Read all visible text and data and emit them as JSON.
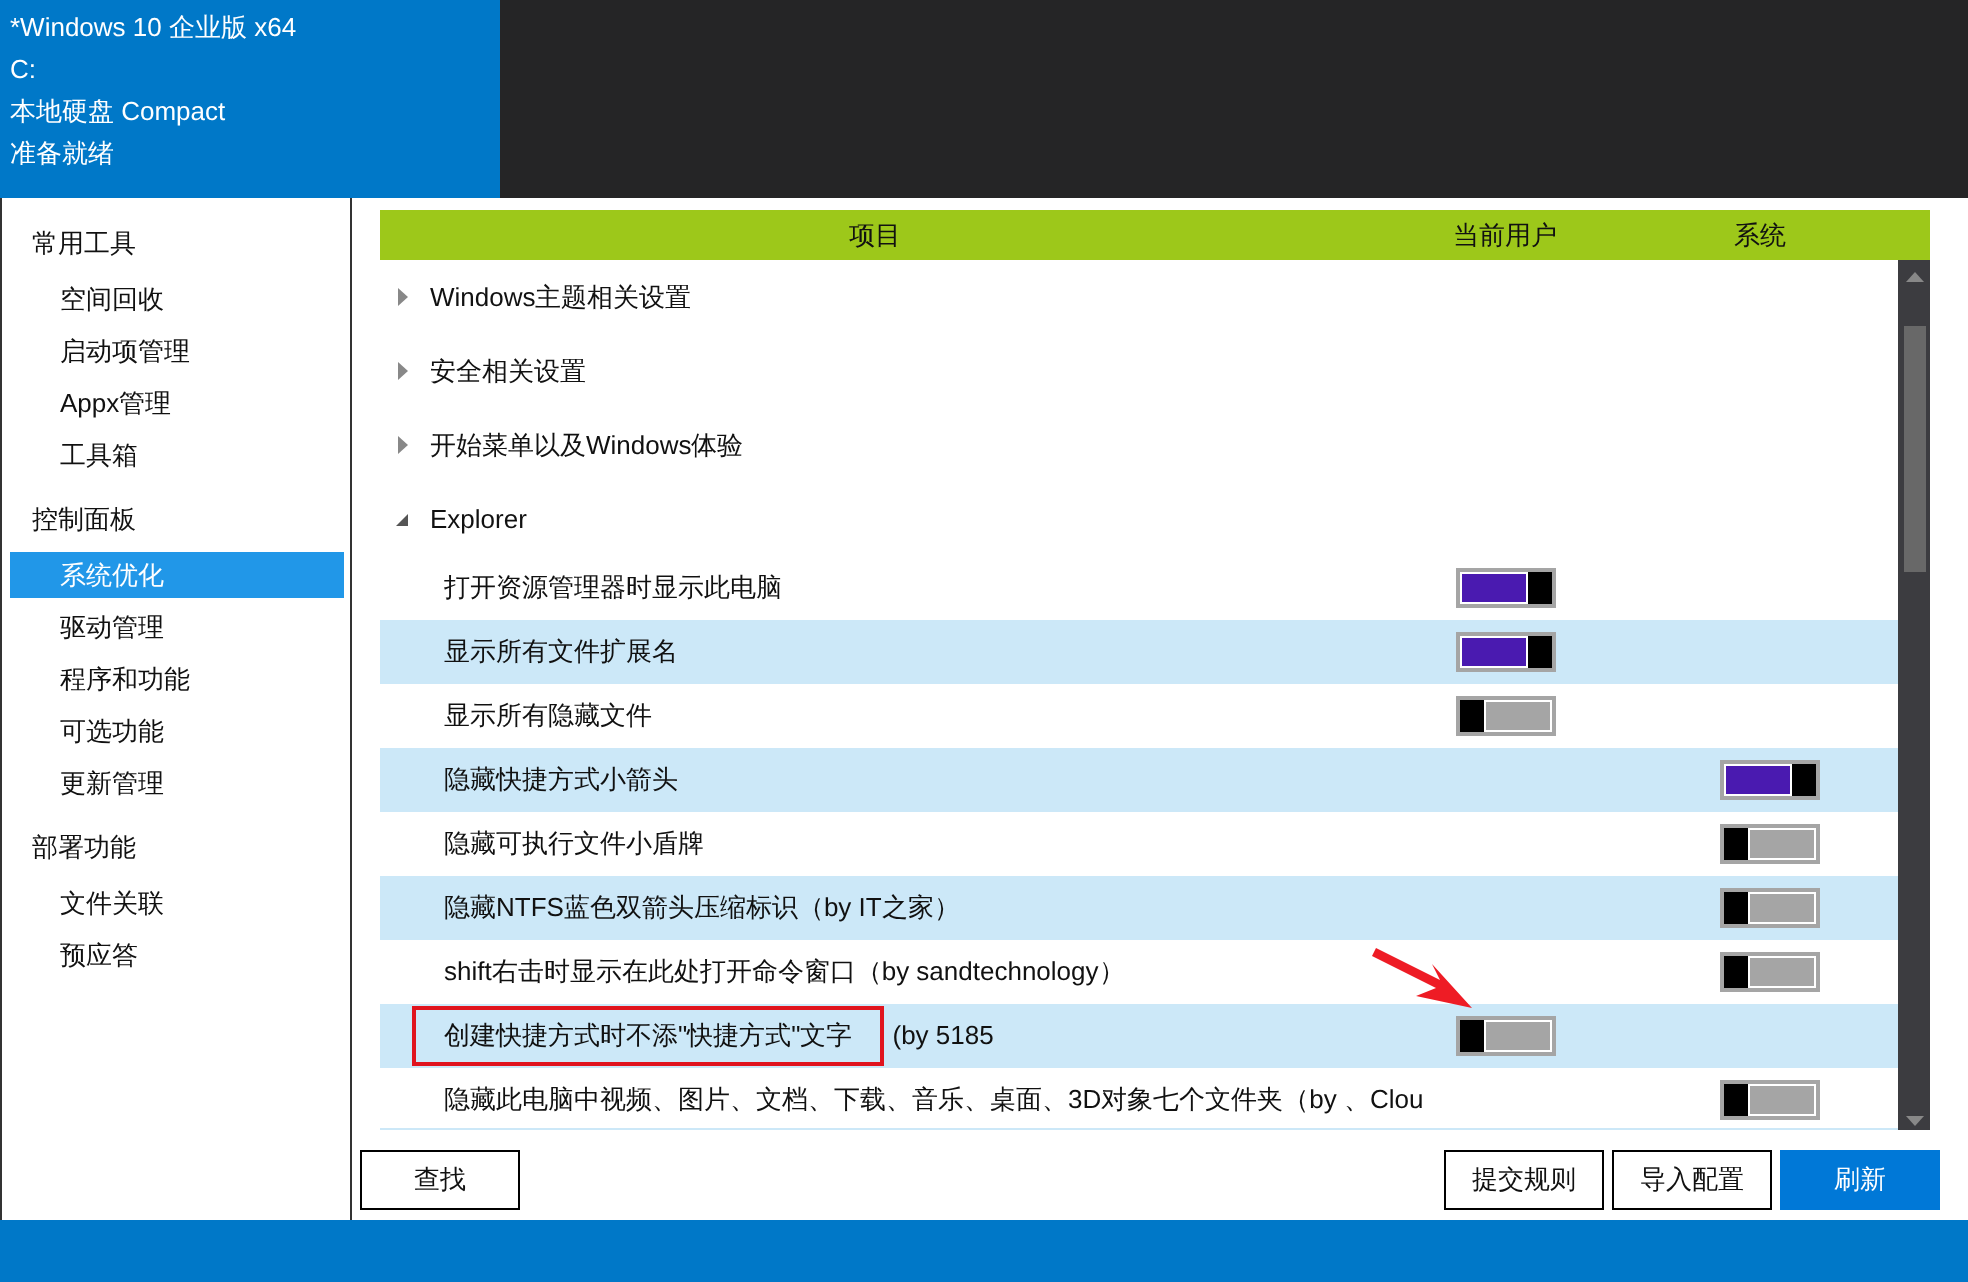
{
  "header": {
    "lines": [
      "*Windows 10 企业版 x64",
      "C:",
      "本地硬盘 Compact",
      "准备就绪"
    ]
  },
  "sidebar": {
    "sections": [
      {
        "title": "常用工具",
        "items": [
          {
            "label": "空间回收",
            "selected": false
          },
          {
            "label": "启动项管理",
            "selected": false
          },
          {
            "label": "Appx管理",
            "selected": false
          },
          {
            "label": "工具箱",
            "selected": false
          }
        ]
      },
      {
        "title": "控制面板",
        "items": [
          {
            "label": "系统优化",
            "selected": true
          },
          {
            "label": "驱动管理",
            "selected": false
          },
          {
            "label": "程序和功能",
            "selected": false
          },
          {
            "label": "可选功能",
            "selected": false
          },
          {
            "label": "更新管理",
            "selected": false
          }
        ]
      },
      {
        "title": "部署功能",
        "items": [
          {
            "label": "文件关联",
            "selected": false
          },
          {
            "label": "预应答",
            "selected": false
          }
        ]
      }
    ]
  },
  "table": {
    "columns": [
      "项目",
      "当前用户",
      "系统"
    ],
    "rows": [
      {
        "label": "Windows主题相关设置",
        "expanded": false
      },
      {
        "label": "安全相关设置",
        "expanded": false
      },
      {
        "label": "开始菜单以及Windows体验",
        "expanded": false
      },
      {
        "label": "Explorer",
        "expanded": true,
        "children": [
          {
            "label": "打开资源管理器时显示此电脑",
            "user": {
              "on": true
            }
          },
          {
            "label": "显示所有文件扩展名",
            "user": {
              "on": true
            }
          },
          {
            "label": "显示所有隐藏文件",
            "user": {
              "on": false
            }
          },
          {
            "label": "隐藏快捷方式小箭头",
            "system": {
              "on": true
            }
          },
          {
            "label": "隐藏可执行文件小盾牌",
            "system": {
              "on": false
            }
          },
          {
            "label": "隐藏NTFS蓝色双箭头压缩标识（by IT之家）",
            "system": {
              "on": false
            }
          },
          {
            "label": "shift右击时显示在此处打开命令窗口（by sandtechnology）",
            "system": {
              "on": false
            }
          },
          {
            "label": "创建快捷方式时不添\"快捷方式\"文字",
            "note": "(by 5185",
            "annotated": true,
            "user": {
              "on": false
            }
          },
          {
            "label": "隐藏此电脑中视频、图片、文档、下载、音乐、桌面、3D对象七个文件夹（by 、Clou",
            "system": {
              "on": false
            }
          }
        ]
      }
    ]
  },
  "buttons": {
    "left": [
      "查找"
    ],
    "right": [
      {
        "label": "提交规则",
        "primary": false
      },
      {
        "label": "导入配置",
        "primary": false
      },
      {
        "label": "刷新",
        "primary": true
      }
    ]
  }
}
